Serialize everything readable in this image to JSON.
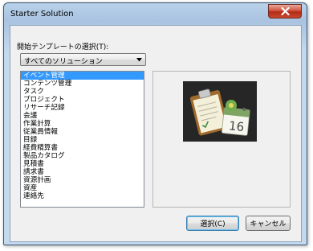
{
  "window": {
    "title": "Starter Solution"
  },
  "template_select": {
    "label": "開始テンプレートの選択(T):",
    "dropdown_value": "すべてのソリューション"
  },
  "list": {
    "items": [
      "イベント管理",
      "コンテンツ管理",
      "タスク",
      "プロジェクト",
      "リサーチ記録",
      "会議",
      "作業計算",
      "従業員情報",
      "目録",
      "経費精算書",
      "製品カタログ",
      "見積書",
      "請求書",
      "資源計画",
      "資産",
      "連絡先"
    ],
    "selected_index": 0
  },
  "buttons": {
    "ok": "選択(C)",
    "cancel": "キャンセル"
  },
  "colors": {
    "selection": "#3399ff",
    "close_button": "#c9472d",
    "titlebar": "#b9d1ea"
  },
  "icons": {
    "close": "close-icon",
    "dropdown": "chevron-down-icon",
    "preview": "clipboard-calendar-icon"
  }
}
